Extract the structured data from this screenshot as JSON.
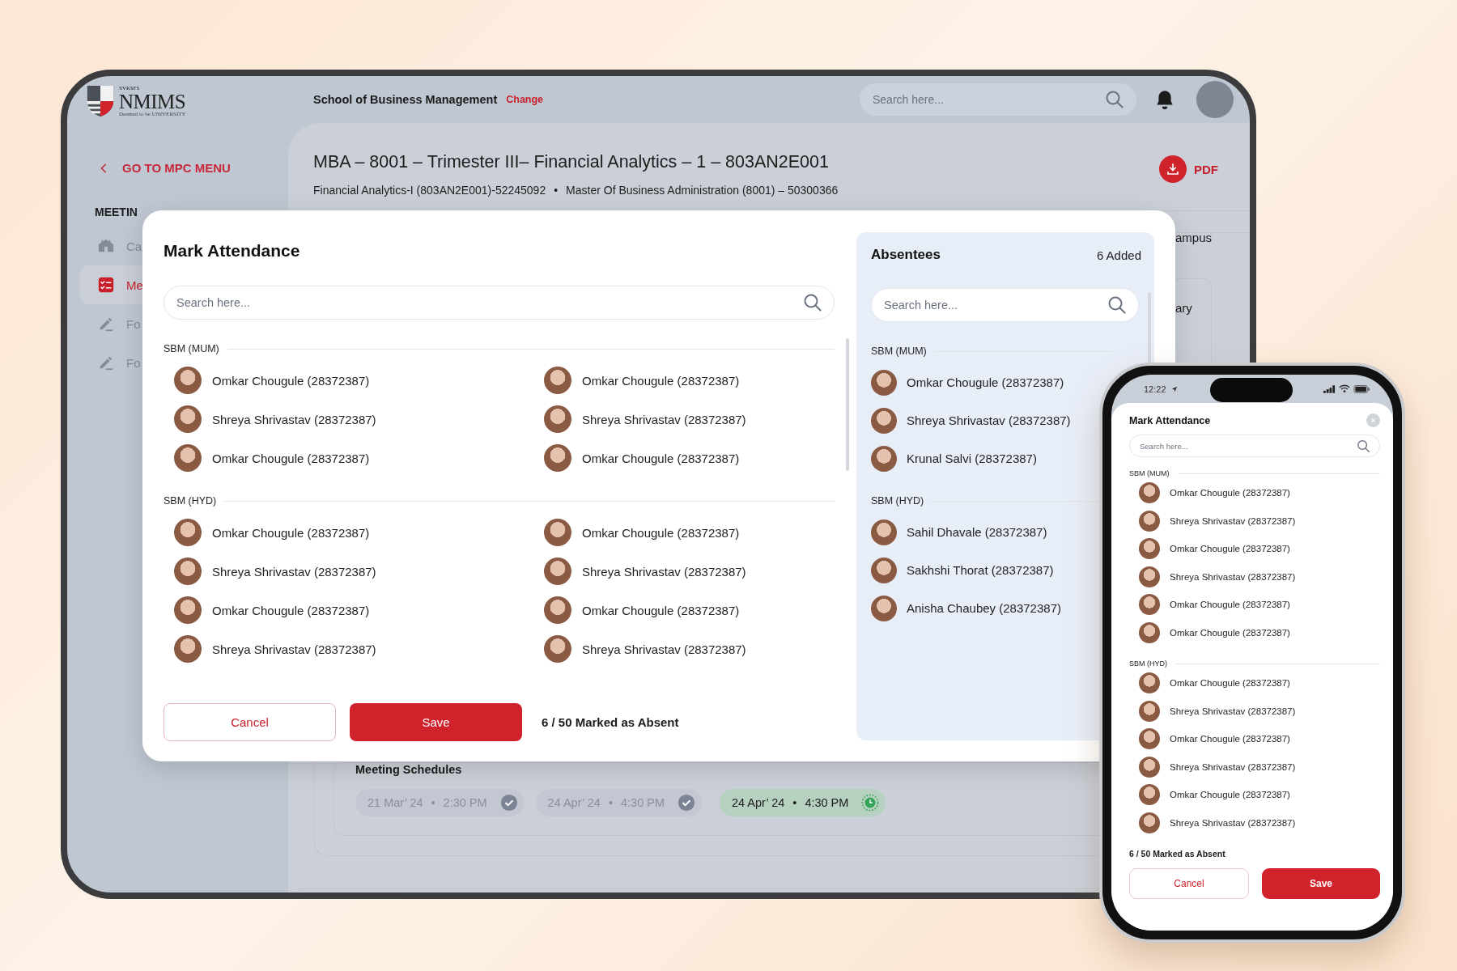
{
  "tablet": {
    "logo": {
      "top": "SVKM'S",
      "name": "NMIMS",
      "bottom": "Deemed to be UNIVERSITY"
    },
    "header": {
      "school": "School of Business Management",
      "change": "Change",
      "search_placeholder": "Search here..."
    },
    "sidebar": {
      "back": "GO TO MPC MENU",
      "section": "MEETIN",
      "items": [
        {
          "label": "Ca",
          "kind": "building",
          "selected": false
        },
        {
          "label": "Me",
          "kind": "checklist",
          "selected": true
        },
        {
          "label": "Fo",
          "kind": "pencil",
          "selected": false
        },
        {
          "label": "Fo",
          "kind": "pencil",
          "selected": false
        }
      ]
    },
    "page": {
      "title": "MBA – 8001 – Trimester III– Financial Analytics – 1 – 803AN2E001",
      "subtitle": [
        "Financial Analytics-I (803AN2E001)-52245092",
        "•",
        "Master Of Business Administration (8001) – 50300366"
      ],
      "pdf": "PDF",
      "covered_texts": [
        "ampus",
        "ary"
      ],
      "schedules": {
        "title": "Meeting Schedules",
        "items": [
          {
            "date": "21 Mar’ 24",
            "separator": "•",
            "time": "2:30 PM",
            "kind": "done"
          },
          {
            "date": "24 Apr’ 24",
            "separator": "•",
            "time": "4:30 PM",
            "kind": "done"
          },
          {
            "date": "24 Apr’ 24",
            "separator": "•",
            "time": "4:30 PM",
            "kind": "current"
          }
        ]
      }
    },
    "modal": {
      "title": "Mark Attendance",
      "search_placeholder": "Search here...",
      "groups": [
        {
          "name": "SBM (MUM)",
          "students": [
            "Omkar Chougule (28372387)",
            "Omkar Chougule (28372387)",
            "Shreya Shrivastav (28372387)",
            "Shreya Shrivastav (28372387)",
            "Omkar Chougule (28372387)",
            "Omkar Chougule (28372387)"
          ]
        },
        {
          "name": "SBM (HYD)",
          "students": [
            "Omkar Chougule (28372387)",
            "Omkar Chougule (28372387)",
            "Shreya Shrivastav (28372387)",
            "Shreya Shrivastav (28372387)",
            "Omkar Chougule (28372387)",
            "Omkar Chougule (28372387)",
            "Shreya Shrivastav (28372387)",
            "Shreya Shrivastav (28372387)"
          ]
        }
      ],
      "cancel": "Cancel",
      "save": "Save",
      "summary": "6 / 50 Marked as Absent",
      "absentees": {
        "title": "Absentees",
        "count": "6 Added",
        "search_placeholder": "Search here...",
        "groups": [
          {
            "name": "SBM (MUM)",
            "students": [
              "Omkar Chougule (28372387)",
              "Shreya Shrivastav (28372387)",
              "Krunal Salvi (28372387)"
            ]
          },
          {
            "name": "SBM (HYD)",
            "students": [
              "Sahil Dhavale (28372387)",
              "Sakhshi Thorat (28372387)",
              "Anisha Chaubey (28372387)"
            ]
          }
        ]
      }
    }
  },
  "phone": {
    "time": "12:22",
    "title": "Mark Attendance",
    "search_placeholder": "Search here...",
    "groups": [
      {
        "name": "SBM (MUM)",
        "students": [
          "Omkar Chougule (28372387)",
          "Shreya Shrivastav (28372387)",
          "Omkar Chougule (28372387)",
          "Shreya Shrivastav (28372387)",
          "Omkar Chougule (28372387)",
          "Omkar Chougule (28372387)"
        ]
      },
      {
        "name": "SBM (HYD)",
        "students": [
          "Omkar Chougule (28372387)",
          "Shreya Shrivastav (28372387)",
          "Omkar Chougule (28372387)",
          "Shreya Shrivastav (28372387)",
          "Omkar Chougule (28372387)",
          "Shreya Shrivastav (28372387)"
        ]
      }
    ],
    "summary": "6 / 50 Marked as Absent",
    "cancel": "Cancel",
    "save": "Save"
  }
}
